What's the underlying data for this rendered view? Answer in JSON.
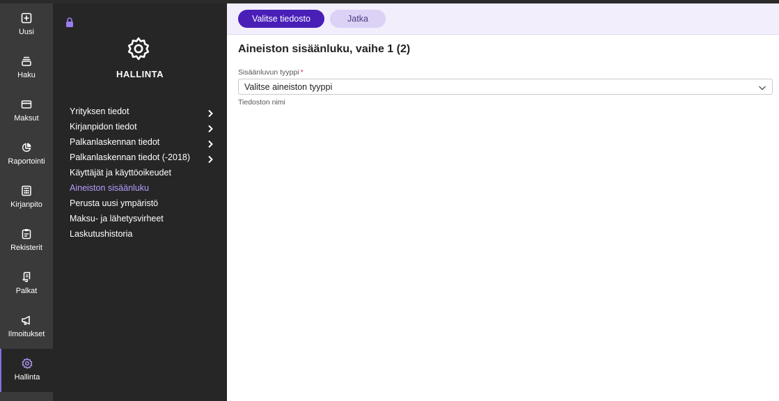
{
  "rail": {
    "items": [
      {
        "label": "Uusi",
        "icon": "plus-square-icon"
      },
      {
        "label": "Haku",
        "icon": "stack-icon"
      },
      {
        "label": "Maksut",
        "icon": "credit-card-icon"
      },
      {
        "label": "Raportointi",
        "icon": "pie-chart-icon"
      },
      {
        "label": "Kirjanpito",
        "icon": "calculator-icon"
      },
      {
        "label": "Rekisterit",
        "icon": "clipboard-icon"
      },
      {
        "label": "Palkat",
        "icon": "scroll-icon"
      },
      {
        "label": "Ilmoitukset",
        "icon": "megaphone-icon"
      },
      {
        "label": "Hallinta",
        "icon": "gear-icon",
        "active": true
      }
    ]
  },
  "subnav": {
    "title": "HALLINTA",
    "items": [
      {
        "label": "Yrityksen tiedot",
        "has_children": true
      },
      {
        "label": "Kirjanpidon tiedot",
        "has_children": true
      },
      {
        "label": "Palkanlaskennan tiedot",
        "has_children": true
      },
      {
        "label": "Palkanlaskennan tiedot (-2018)",
        "has_children": true
      },
      {
        "label": "Käyttäjät ja käyttöoikeudet",
        "has_children": false
      },
      {
        "label": "Aineiston sisäänluku",
        "has_children": false,
        "active": true
      },
      {
        "label": "Perusta uusi ympäristö",
        "has_children": false
      },
      {
        "label": "Maksu- ja lähetysvirheet",
        "has_children": false
      },
      {
        "label": "Laskutushistoria",
        "has_children": false
      }
    ]
  },
  "toolbar": {
    "choose_file_label": "Valitse tiedosto",
    "continue_label": "Jatka"
  },
  "main": {
    "title": "Aineiston sisäänluku, vaihe 1 (2)",
    "type_field": {
      "label": "Sisäänluvun tyyppi",
      "required_marker": "*",
      "value": "Valitse aineiston tyyppi"
    },
    "file_name_label": "Tiedoston nimi"
  },
  "colors": {
    "accent": "#4a1fb8",
    "active_menu": "#b79cff",
    "rail_bg": "#3a3a3a",
    "subnav_bg": "#262626"
  }
}
